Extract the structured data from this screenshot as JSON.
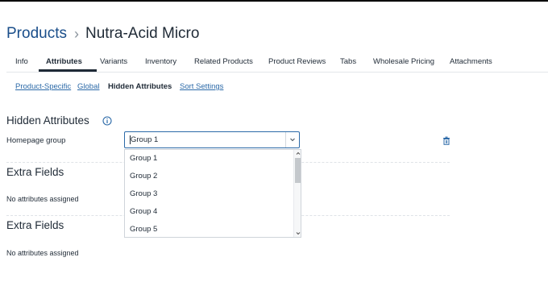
{
  "breadcrumb": {
    "parent": "Products",
    "separator": "›",
    "title": "Nutra-Acid Micro"
  },
  "tabs": [
    {
      "label": "Info"
    },
    {
      "label": "Attributes",
      "active": true
    },
    {
      "label": "Variants"
    },
    {
      "label": "Inventory"
    },
    {
      "label": "Related Products"
    },
    {
      "label": "Product Reviews"
    },
    {
      "label": "Tabs"
    },
    {
      "label": "Wholesale Pricing"
    },
    {
      "label": "Attachments"
    }
  ],
  "subtabs": [
    {
      "label": "Product-Specific"
    },
    {
      "label": "Global"
    },
    {
      "label": "Hidden Attributes",
      "active": true
    },
    {
      "label": "Sort Settings"
    }
  ],
  "hidden_attributes": {
    "title": "Hidden Attributes",
    "field_label": "Homepage group",
    "select_value": "Group 1",
    "options": [
      "Group 1",
      "Group 2",
      "Group 3",
      "Group 4",
      "Group 5"
    ]
  },
  "extra_fields_1": {
    "title": "Extra Fields",
    "empty_text": "No attributes assigned"
  },
  "extra_fields_2": {
    "title": "Extra Fields",
    "empty_text": "No attributes assigned"
  },
  "colors": {
    "link": "#2c6aa8",
    "breadcrumb": "#1a4e8a",
    "text": "#1f2a36",
    "focus_border": "#2c6aa8"
  },
  "icons": {
    "info": "info-circle-icon",
    "delete": "trash-icon",
    "dropdown": "chevron-down-icon"
  }
}
